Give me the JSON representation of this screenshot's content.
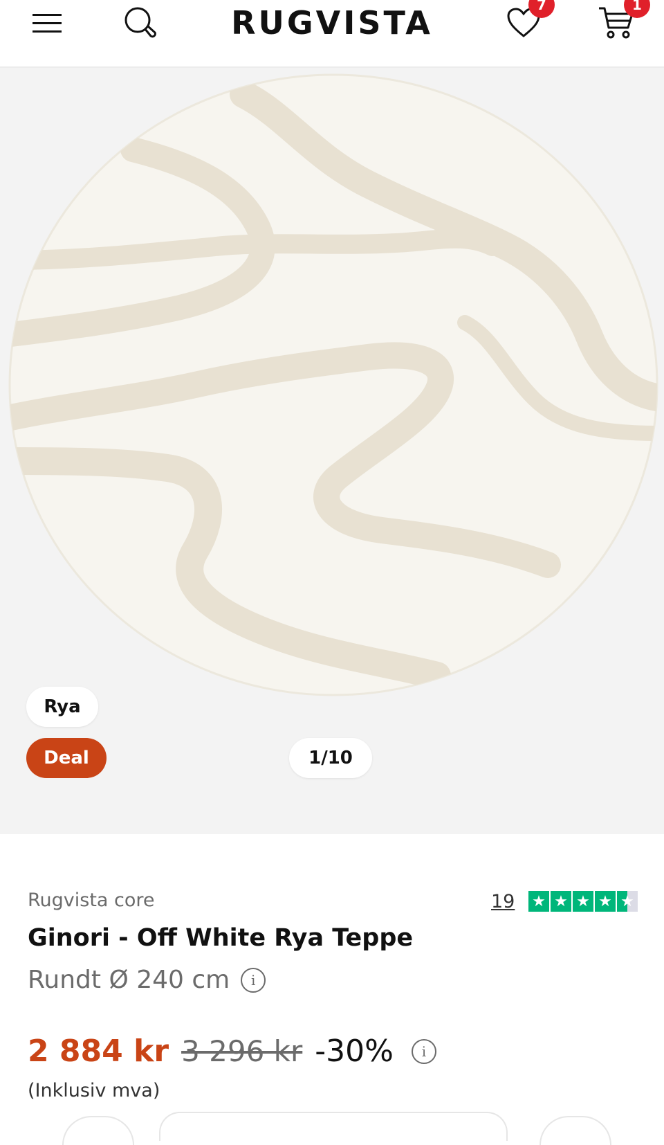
{
  "header": {
    "logo": "RUGVISTA",
    "wishlist_count": "7",
    "cart_count": "1"
  },
  "gallery": {
    "chip_material": "Rya",
    "chip_deal": "Deal",
    "counter": "1/10"
  },
  "product": {
    "brand": "Rugvista core",
    "title": "Ginori - Off White Rya Teppe",
    "size": "Rundt Ø 240 cm",
    "review_count": "19",
    "rating_stars": 4.5,
    "price_current": "2 884 kr",
    "price_original": "3 296 kr",
    "discount": "-30%",
    "vat_note": "(Inklusiv mva)"
  },
  "colors": {
    "accent": "#c94416",
    "badge": "#e0202a",
    "trustpilot": "#00b67a"
  }
}
